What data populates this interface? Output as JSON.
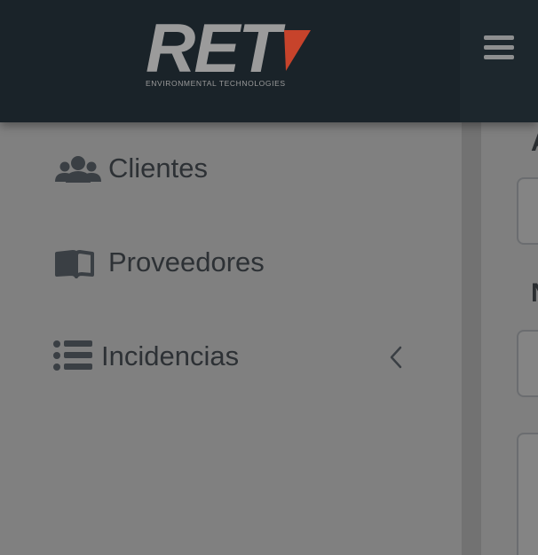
{
  "header": {
    "logo_text": "RET",
    "logo_subtitle": "ENVIRONMENTAL TECHNOLOGIES",
    "menu_icon": "hamburger-icon"
  },
  "sidebar": {
    "items": [
      {
        "label": "Clientes",
        "icon": "users-icon"
      },
      {
        "label": "Proveedores",
        "icon": "book-icon"
      },
      {
        "label": "Incidencias",
        "icon": "list-icon",
        "expand_icon": "chevron-left-icon"
      }
    ]
  },
  "main": {
    "heading_1": "A",
    "heading_2": "N"
  },
  "colors": {
    "header_bg": "#1b242a",
    "overlay_gray": "#808080",
    "logo_accent": "#c7432b",
    "logo_letters": "#9b9b9b"
  }
}
